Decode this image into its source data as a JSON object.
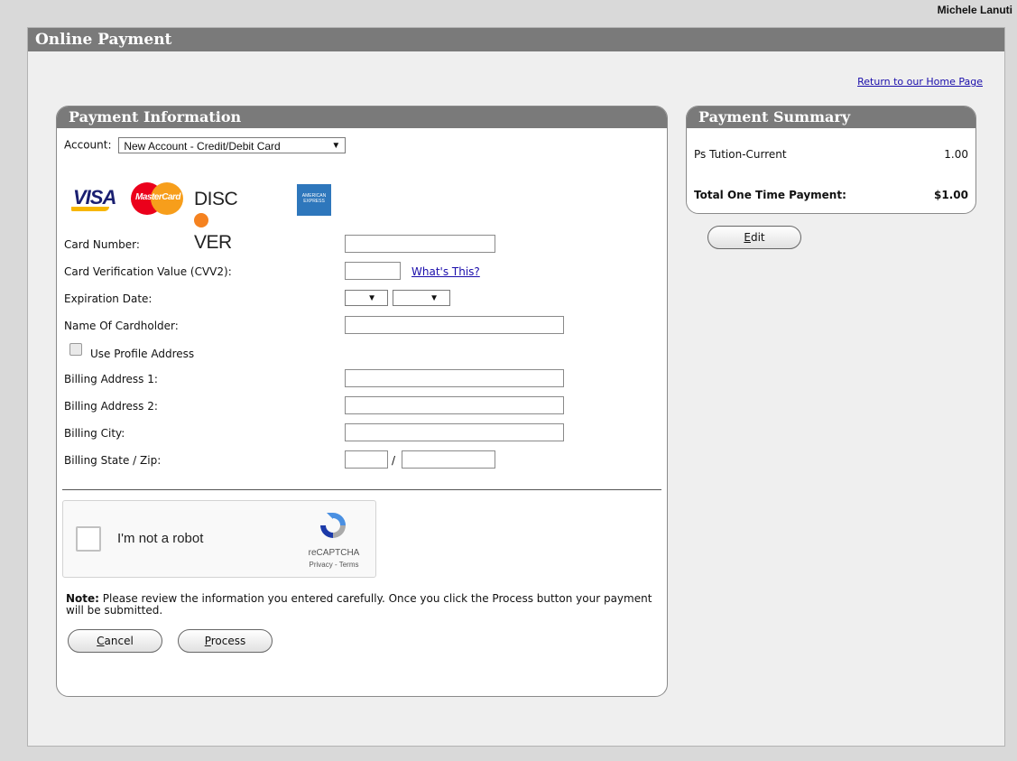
{
  "user": {
    "name": "Michele Lanuti"
  },
  "page": {
    "title": "Online Payment",
    "home_link": "Return to our Home Page"
  },
  "payment_info": {
    "header": "Payment Information",
    "account_label": "Account:",
    "account_value": "New Account - Credit/Debit Card",
    "card_logos": [
      "VISA",
      "MasterCard",
      "DISCOVER",
      "AMERICAN EXPRESS"
    ],
    "fields": {
      "card_number": "Card Number:",
      "cvv": "Card Verification Value (CVV2):",
      "cvv_help": "What's This?",
      "expiration": "Expiration Date:",
      "cardholder": "Name Of Cardholder:",
      "use_profile": "Use Profile Address",
      "billing1": "Billing Address 1:",
      "billing2": "Billing Address 2:",
      "city": "Billing City:",
      "state_zip": "Billing State / Zip:",
      "separator": "/"
    },
    "captcha": {
      "label": "I'm not a robot",
      "brand": "reCAPTCHA",
      "terms": "Privacy - Terms"
    },
    "note_label": "Note:",
    "note_text": "Please review the information you entered carefully. Once you click the Process button your payment will be submitted.",
    "buttons": {
      "cancel_first": "C",
      "cancel_rest": "ancel",
      "process_first": "P",
      "process_rest": "rocess"
    }
  },
  "summary": {
    "header": "Payment Summary",
    "item_label": "Ps Tution-Current",
    "item_amount": "1.00",
    "total_label": "Total One Time Payment:",
    "total_amount": "$1.00",
    "edit_first": "E",
    "edit_rest": "dit"
  },
  "colors": {
    "header_bg": "#7a7a7a",
    "link": "#1a0dab"
  }
}
